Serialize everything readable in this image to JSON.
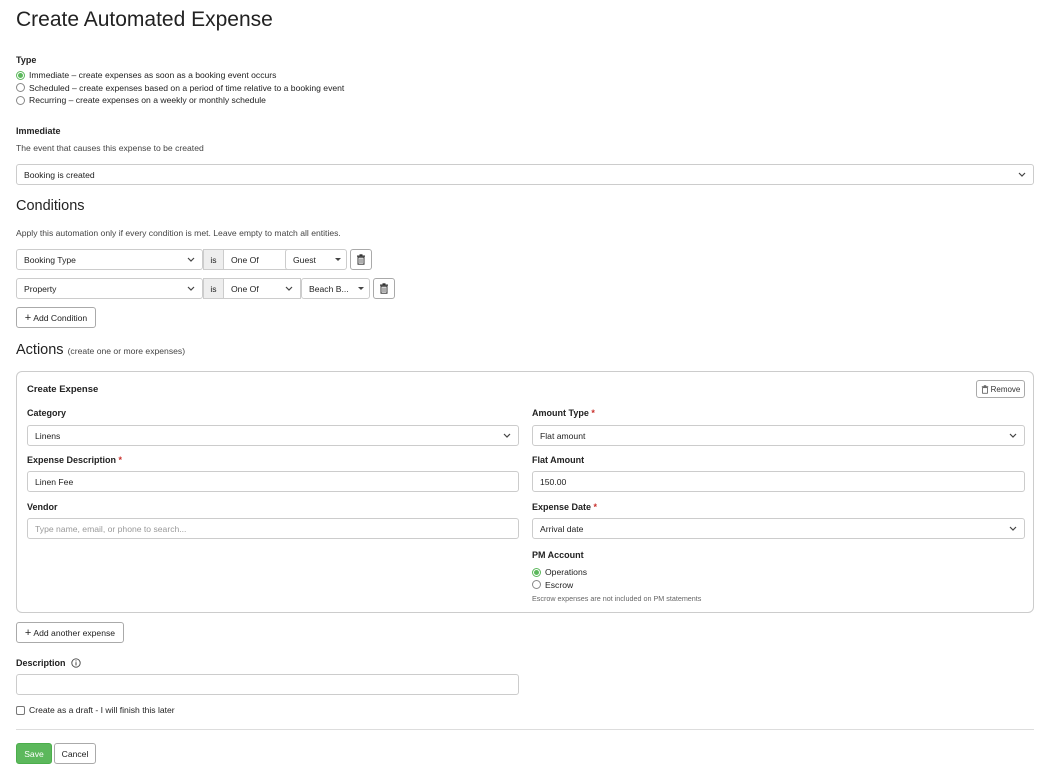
{
  "page": {
    "title": "Create Automated Expense"
  },
  "type": {
    "heading": "Type",
    "options": [
      {
        "label": "Immediate – create expenses as soon as a booking event occurs",
        "selected": true
      },
      {
        "label": "Scheduled – create expenses based on a period of time relative to a booking event",
        "selected": false
      },
      {
        "label": "Recurring – create expenses on a weekly or monthly schedule",
        "selected": false
      }
    ]
  },
  "immediate": {
    "heading": "Immediate",
    "help": "The event that causes this expense to be created",
    "event_value": "Booking is created"
  },
  "conditions": {
    "heading": "Conditions",
    "help": "Apply this automation only if every condition is met. Leave empty to match all entities.",
    "rows": [
      {
        "field": "Booking Type",
        "op": "is",
        "mode": "One Of",
        "value": "Guest"
      },
      {
        "field": "Property",
        "op": "is",
        "mode": "One Of",
        "value": "Beach B..."
      }
    ],
    "add_label": "Add Condition"
  },
  "actions": {
    "heading": "Actions",
    "subheading": "(create one or more expenses)",
    "card": {
      "title": "Create Expense",
      "remove_label": "Remove",
      "category_label": "Category",
      "category_value": "Linens",
      "description_label": "Expense Description",
      "description_value": "Linen Fee",
      "vendor_label": "Vendor",
      "vendor_placeholder": "Type name, email, or phone to search...",
      "amount_type_label": "Amount Type",
      "amount_type_value": "Flat amount",
      "flat_amount_label": "Flat Amount",
      "flat_amount_value": "150.00",
      "expense_date_label": "Expense Date",
      "expense_date_value": "Arrival date",
      "pm_account_label": "PM Account",
      "pm_options": [
        {
          "label": "Operations",
          "selected": true
        },
        {
          "label": "Escrow",
          "selected": false
        }
      ],
      "pm_note": "Escrow expenses are not included on PM statements",
      "required_mark": "*"
    },
    "add_another_label": "Add another expense"
  },
  "description": {
    "label": "Description",
    "value": ""
  },
  "draft": {
    "label": "Create as a draft - I will finish this later",
    "checked": false
  },
  "footer": {
    "save_label": "Save",
    "cancel_label": "Cancel"
  },
  "colors": {
    "accent_green": "#5cb85c",
    "required_red": "#c9302c",
    "border": "#cccccc"
  }
}
